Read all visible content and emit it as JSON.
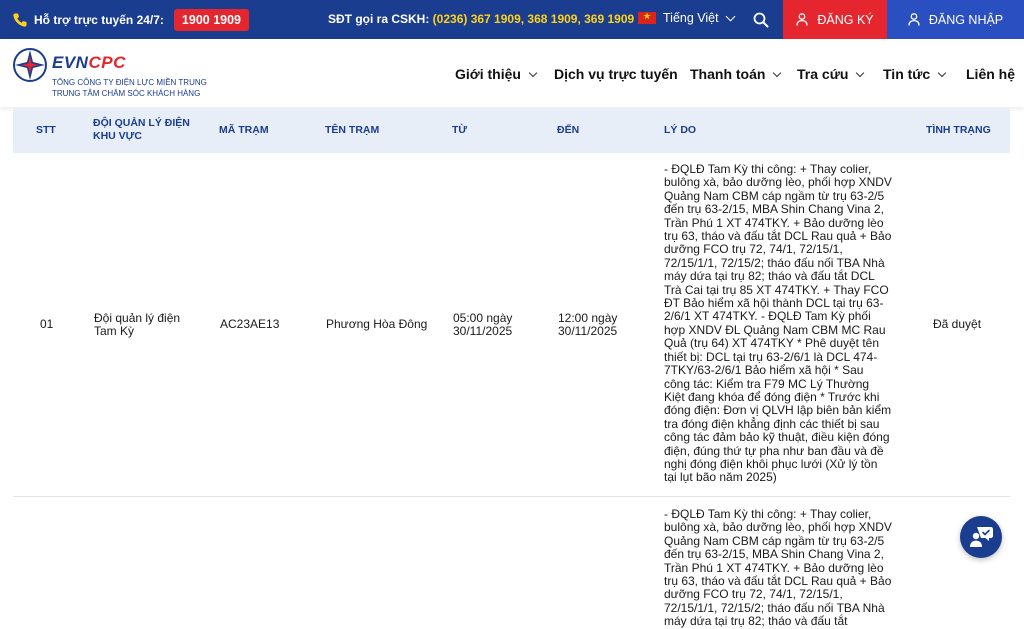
{
  "topbar": {
    "hotline_label": "Hỗ trợ trực tuyến 24/7:",
    "hotline_number": "1900 1909",
    "cskh_label": "SĐT gọi ra CSKH: ",
    "cskh_numbers": "(0236) 367 1909, 368 1909, 369 1909",
    "language": "Tiếng Việt",
    "register_label": "ĐĂNG KÝ",
    "login_label": "ĐĂNG NHẬP"
  },
  "logo": {
    "brand_evn": "EVN",
    "brand_cpc": "CPC",
    "line1": "TỔNG CÔNG TY ĐIỆN LỰC MIỀN TRUNG",
    "line2": "TRUNG TÂM CHĂM SÓC KHÁCH HÀNG"
  },
  "nav": [
    "Giới thiệu",
    "Dịch vụ trực tuyến",
    "Thanh toán",
    "Tra cứu",
    "Tin tức",
    "Liên hệ"
  ],
  "table": {
    "headers": [
      "STT",
      "ĐỘI QUẢN LÝ ĐIỆN KHU VỰC",
      "MÃ TRẠM",
      "TÊN TRẠM",
      "TỪ",
      "ĐẾN",
      "LÝ DO",
      "TÌNH TRẠNG"
    ],
    "rows": [
      {
        "stt": "01",
        "doi": "Đội quản lý điện Tam Kỳ",
        "ma_tram": "AC23AE13",
        "ten_tram": "Phương Hòa Đông",
        "tu": "05:00 ngày 30/11/2025",
        "den": "12:00 ngày 30/11/2025",
        "ly_do": "- ĐQLĐ Tam Kỳ thi công: + Thay colier, bulông xà, bảo dưỡng lèo, phối hợp XNDV Quảng Nam CBM cáp ngầm từ trụ 63-2/5 đến trụ 63-2/15, MBA Shin Chang Vina 2, Trần Phú 1 XT 474TKY. + Bảo dưỡng lèo trụ 63, tháo và đấu tắt DCL Rau quả + Bảo dưỡng FCO trụ 72, 74/1, 72/15/1, 72/15/1/1, 72/15/2; tháo đấu nối TBA Nhà máy dứa tại trụ 82; tháo và đấu tắt DCL Trà Cai tại trụ 85 XT 474TKY. + Thay FCO ĐT Bảo hiểm xã hội thành DCL tại trụ 63-2/6/1 XT 474TKY. - ĐQLĐ Tam Kỳ phối hợp XNDV ĐL Quảng Nam CBM MC Rau Quả (trụ 64) XT 474TKY * Phê duyệt tên thiết bị: DCL tại trụ 63-2/6/1 là DCL 474-7TKY/63-2/6/1 Bảo hiểm xã hội * Sau công tác: Kiểm tra F79 MC Lý Thường Kiệt đang khóa để đóng điện * Trước khi đóng điện: Đơn vị QLVH lập biên bản kiểm tra đóng điện khẳng định các thiết bị sau công tác đảm bảo kỹ thuật, điều kiện đóng điện, đúng thứ tự pha như ban đầu và đề nghị đóng điện khôi phục lưới (Xử lý tồn tại lụt bão năm 2025)",
        "tinh_trang": "Đã duyệt"
      },
      {
        "ly_do": "- ĐQLĐ Tam Kỳ thi công: + Thay colier, bulông xà, bảo dưỡng lèo, phối hợp XNDV Quảng Nam CBM cáp ngầm từ trụ 63-2/5 đến trụ 63-2/15, MBA Shin Chang Vina 2, Trần Phú 1 XT 474TKY. + Bảo dưỡng lèo trụ 63, tháo và đấu tắt DCL Rau quả + Bảo dưỡng FCO trụ 72, 74/1, 72/15/1, 72/15/1/1, 72/15/2; tháo đấu nối TBA Nhà máy dứa tại trụ 82; tháo và đấu tắt"
      }
    ]
  },
  "colors": {
    "topbar": "#1a3d8f",
    "accent_red": "#e5262e",
    "login_blue": "#2a4fc0",
    "highlight_yellow": "#ffd21a",
    "table_header_bg": "#e8eef8"
  },
  "icons": {
    "phone": "phone-icon",
    "search": "search-icon",
    "user": "user-icon",
    "chat": "chat-support-icon"
  }
}
